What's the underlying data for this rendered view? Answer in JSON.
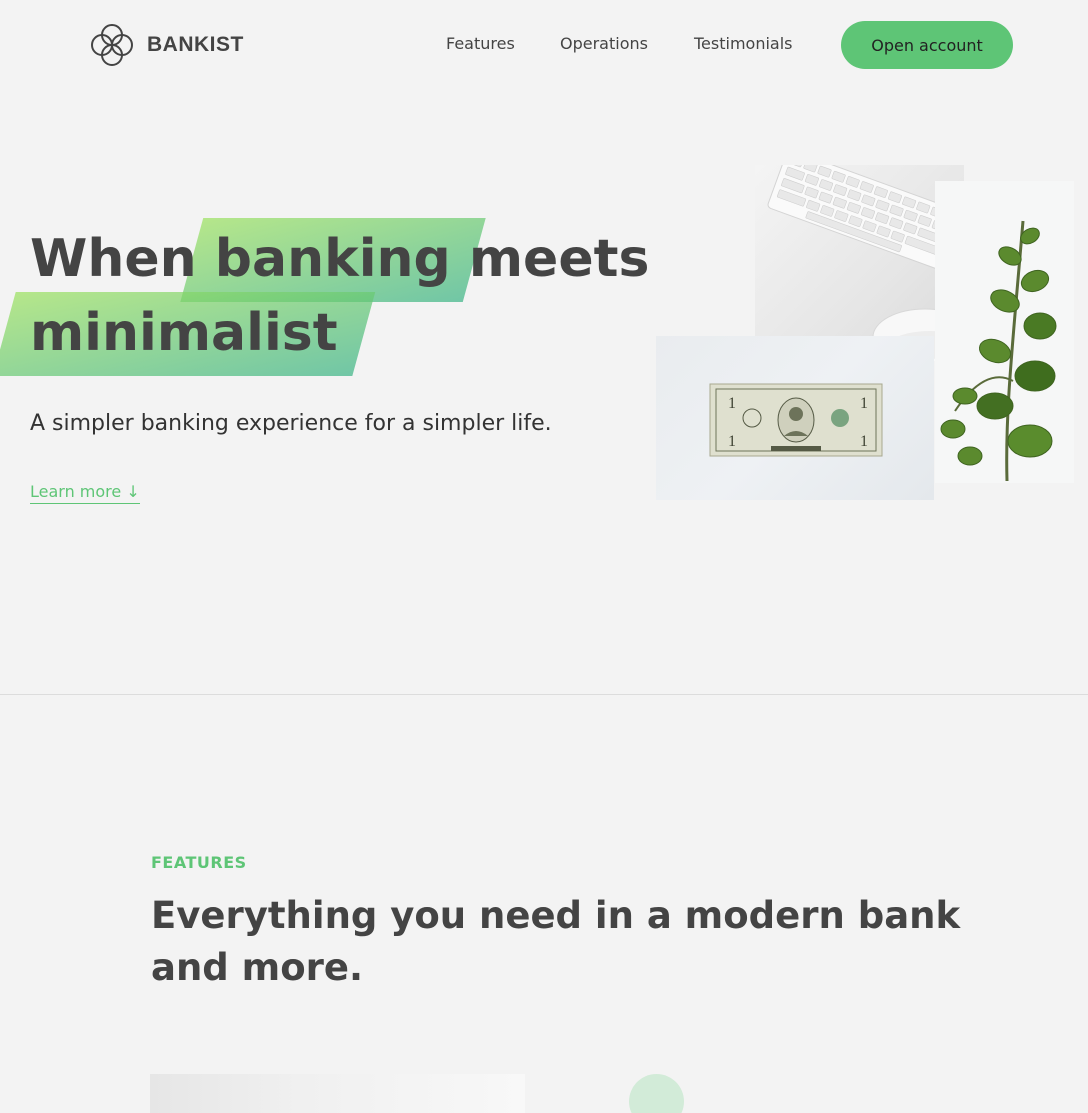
{
  "nav": {
    "logo_text": "BANKIST",
    "links": [
      "Features",
      "Operations",
      "Testimonials"
    ],
    "cta_label": "Open account"
  },
  "hero": {
    "title_part1": "When",
    "title_highlight1": "banking",
    "title_part2": "meets",
    "title_highlight2": "minimalist",
    "subtitle": "A simpler banking experience for a simpler life.",
    "learn_more": "Learn more ↓"
  },
  "features": {
    "label": "FEATURES",
    "title": "Everything you need in a modern bank and more."
  },
  "colors": {
    "primary": "#5ec576",
    "text": "#444444",
    "background": "#f3f3f3",
    "gradient_start": "#9be15d",
    "gradient_end": "#39b385"
  }
}
